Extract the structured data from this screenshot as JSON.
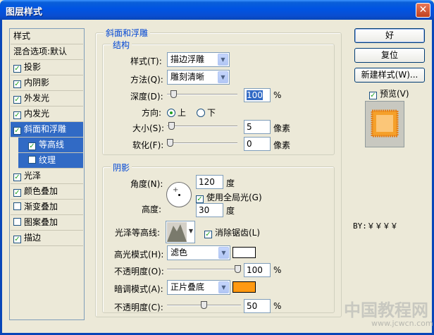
{
  "window": {
    "title": "图层样式",
    "close_glyph": "✕"
  },
  "sidebar": {
    "header": "样式",
    "blend": "混合选项:默认",
    "items": [
      {
        "label": "投影",
        "checked": true
      },
      {
        "label": "内阴影",
        "checked": true
      },
      {
        "label": "外发光",
        "checked": true
      },
      {
        "label": "内发光",
        "checked": true
      },
      {
        "label": "斜面和浮雕",
        "checked": true
      },
      {
        "label": "等高线",
        "checked": true
      },
      {
        "label": "纹理",
        "checked": false
      },
      {
        "label": "光泽",
        "checked": true
      },
      {
        "label": "颜色叠加",
        "checked": true
      },
      {
        "label": "渐变叠加",
        "checked": false
      },
      {
        "label": "图案叠加",
        "checked": false
      },
      {
        "label": "描边",
        "checked": true
      }
    ]
  },
  "bevel": {
    "legend": "斜面和浮雕",
    "structure": {
      "legend": "结构",
      "style_label": "样式(T):",
      "style_value": "描边浮雕",
      "technique_label": "方法(Q):",
      "technique_value": "雕刻清晰",
      "depth_label": "深度(D):",
      "depth_value": "100",
      "depth_unit": "%",
      "depth_level": 0.05,
      "direction_label": "方向:",
      "direction_up": "上",
      "direction_down": "下",
      "direction_selected": "up",
      "size_label": "大小(S):",
      "size_value": "5",
      "size_unit": "像素",
      "size_level": 0.02,
      "soften_label": "软化(F):",
      "soften_value": "0",
      "soften_unit": "像素",
      "soften_level": 0.0
    },
    "shading": {
      "legend": "阴影",
      "angle_label": "角度(N):",
      "angle_value": "120",
      "angle_unit": "度",
      "global_light_label": "使用全局光(G)",
      "global_light_checked": true,
      "altitude_label": "高度:",
      "altitude_value": "30",
      "altitude_unit": "度",
      "gloss_contour_label": "光泽等高线:",
      "anti_aliased_label": "消除锯齿(L)",
      "anti_aliased_checked": true,
      "highlight_mode_label": "高光模式(H):",
      "highlight_mode_value": "滤色",
      "highlight_color": "#ffffff",
      "highlight_opacity_label": "不透明度(O):",
      "highlight_opacity_value": "100",
      "highlight_opacity_unit": "%",
      "highlight_opacity_level": 1.0,
      "shadow_mode_label": "暗调模式(A):",
      "shadow_mode_value": "正片叠底",
      "shadow_color": "#ff9911",
      "shadow_opacity_label": "不透明度(C):",
      "shadow_opacity_value": "50",
      "shadow_opacity_unit": "%",
      "shadow_opacity_level": 0.5
    }
  },
  "buttons": {
    "ok": "好",
    "reset": "复位",
    "new_style": "新建样式(W)...",
    "preview_label": "预览(V)",
    "preview_checked": true
  },
  "by_text": "BY:￥￥￥￥",
  "watermark": {
    "main": "中国教程网",
    "url": "www.jcwcn.com"
  }
}
